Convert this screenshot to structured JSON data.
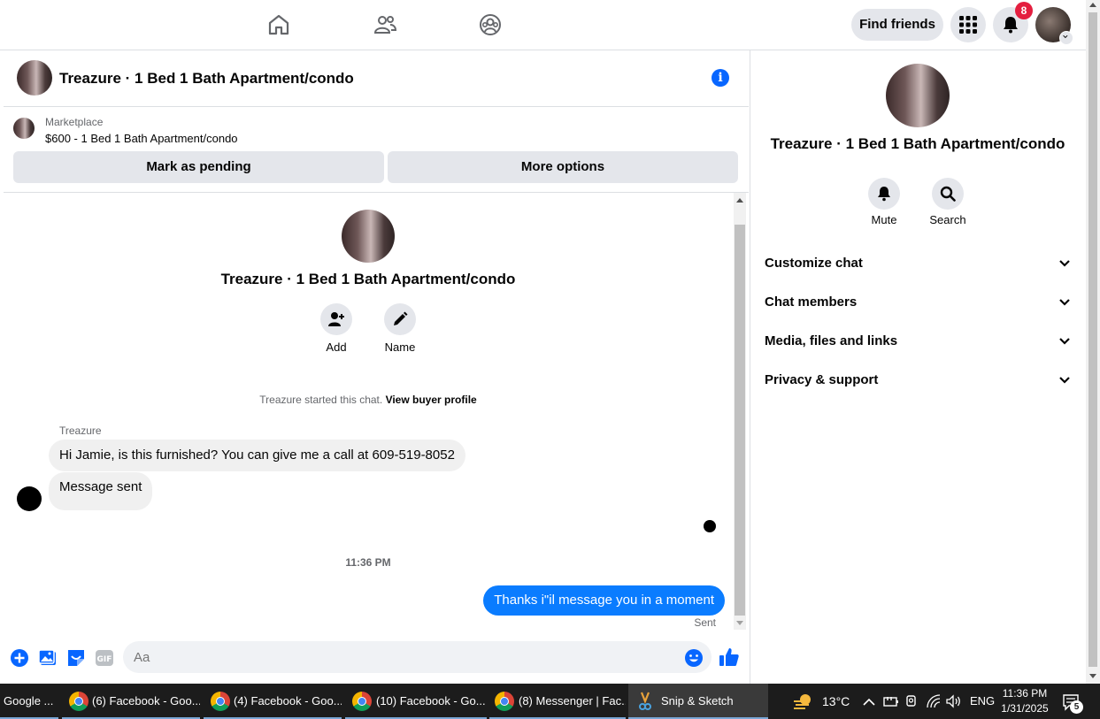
{
  "nav": {
    "find_friends": "Find friends",
    "notification_count": "8"
  },
  "chat": {
    "title": "Treazure · 1 Bed 1 Bath Apartment/condo"
  },
  "marketplace": {
    "label": "Marketplace",
    "listing": "$600 - 1 Bed 1 Bath Apartment/condo",
    "mark_pending": "Mark as pending",
    "more_options": "More options"
  },
  "intro": {
    "title": "Treazure · 1 Bed 1 Bath Apartment/condo",
    "add_label": "Add",
    "name_label": "Name",
    "started_text": "Treazure started this chat.",
    "view_buyer_profile": "View buyer profile"
  },
  "messages": {
    "sender": "Treazure",
    "incoming_1": "Hi Jamie, is this furnished? You can give me a call at 609-519-8052",
    "incoming_2": "Message sent",
    "timestamp": "11:36 PM",
    "outgoing_1": "Thanks i\"il message you in a moment",
    "status": "Sent"
  },
  "composer": {
    "placeholder": "Aa"
  },
  "right_panel": {
    "title": "Treazure · 1 Bed 1 Bath Apartment/condo",
    "mute_label": "Mute",
    "search_label": "Search",
    "sections": [
      "Customize chat",
      "Chat members",
      "Media, files and links",
      "Privacy & support"
    ]
  },
  "taskbar": {
    "items": [
      "Google ...",
      "(6) Facebook - Goo...",
      "(4) Facebook - Goo...",
      "(10) Facebook - Go...",
      "(8) Messenger | Fac...",
      "Snip & Sketch"
    ],
    "temperature": "13°C",
    "language": "ENG",
    "time": "11:36 PM",
    "date": "1/31/2025",
    "notification_count": "5"
  },
  "colors": {
    "accent": "#0866ff",
    "outgoing_bubble": "#0a7cff",
    "badge": "#e41e3f"
  }
}
